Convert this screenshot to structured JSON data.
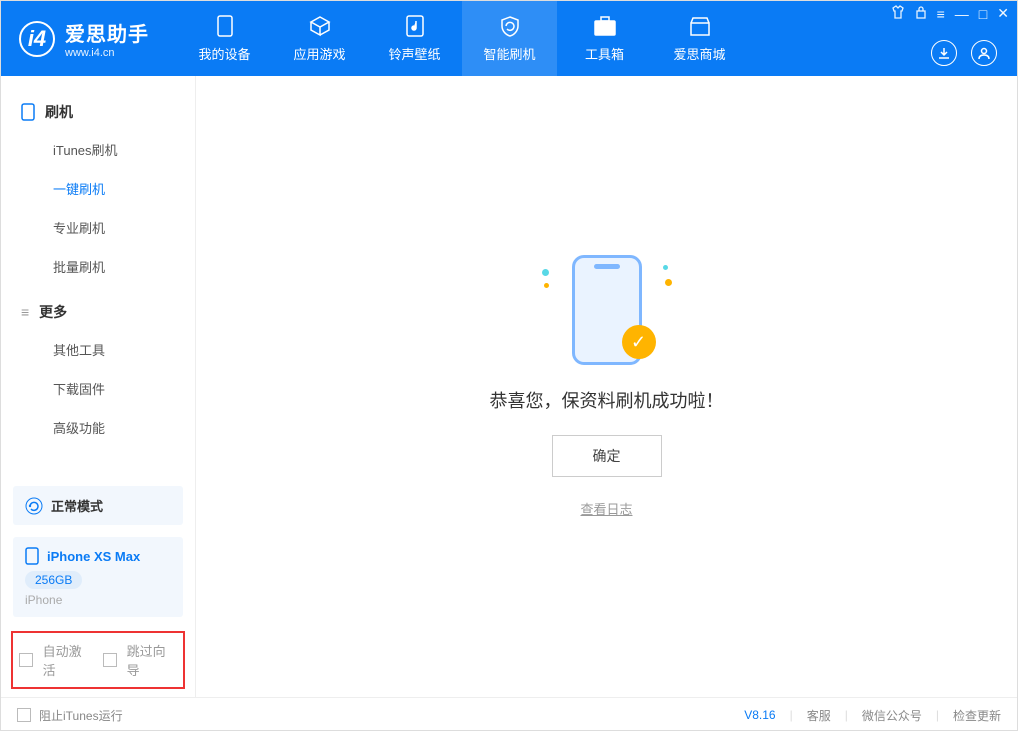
{
  "app": {
    "name": "爱思助手",
    "site": "www.i4.cn"
  },
  "nav": {
    "items": [
      {
        "label": "我的设备"
      },
      {
        "label": "应用游戏"
      },
      {
        "label": "铃声壁纸"
      },
      {
        "label": "智能刷机"
      },
      {
        "label": "工具箱"
      },
      {
        "label": "爱思商城"
      }
    ]
  },
  "sidebar": {
    "group1": {
      "title": "刷机",
      "items": [
        "iTunes刷机",
        "一键刷机",
        "专业刷机",
        "批量刷机"
      ]
    },
    "group2": {
      "title": "更多",
      "items": [
        "其他工具",
        "下载固件",
        "高级功能"
      ]
    }
  },
  "mode": {
    "label": "正常模式"
  },
  "device": {
    "name": "iPhone XS Max",
    "storage": "256GB",
    "type": "iPhone"
  },
  "options": {
    "auto_activate": "自动激活",
    "skip_guide": "跳过向导"
  },
  "main": {
    "success_text": "恭喜您，保资料刷机成功啦！",
    "ok": "确定",
    "view_log": "查看日志"
  },
  "footer": {
    "block_itunes": "阻止iTunes运行",
    "version": "V8.16",
    "cs": "客服",
    "wx": "微信公众号",
    "update": "检查更新"
  }
}
